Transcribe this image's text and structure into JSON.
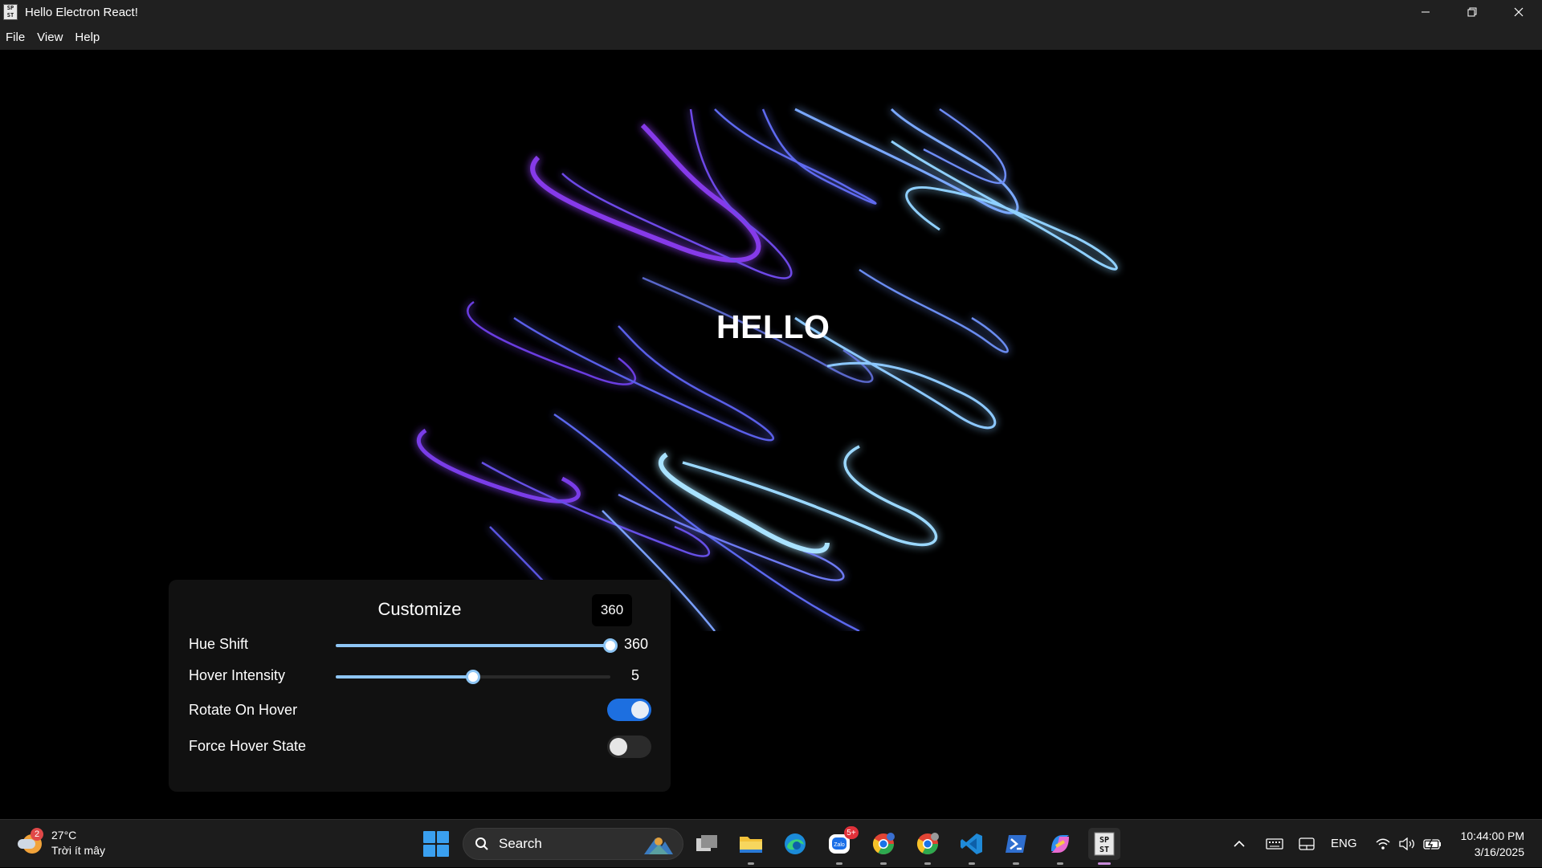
{
  "window": {
    "title": "Hello Electron React!",
    "icon_text_top": "SP",
    "icon_text_bottom": "ST",
    "minimize_icon": "minimize-icon",
    "maximize_icon": "restore-icon",
    "close_icon": "close-icon"
  },
  "menu": {
    "items": [
      {
        "label": "File"
      },
      {
        "label": "View"
      },
      {
        "label": "Help"
      }
    ]
  },
  "main": {
    "heading": "HELLO",
    "artwork": "wavy-purple-blue-lines"
  },
  "customize": {
    "title": "Customize",
    "tooltip": "360",
    "hue_shift": {
      "label": "Hue Shift",
      "value": 360,
      "value_text": "360",
      "max": 360
    },
    "hover_intensity": {
      "label": "Hover Intensity",
      "value": 5,
      "value_text": "5",
      "max": 10
    },
    "rotate_on_hover": {
      "label": "Rotate On Hover",
      "on": true
    },
    "force_hover_state": {
      "label": "Force Hover State",
      "on": false
    },
    "colors": {
      "accent": "#8ec6f5",
      "toggle_on": "#1d6fe0"
    }
  },
  "taskbar": {
    "weather": {
      "temperature": "27°C",
      "description": "Trời ít mây",
      "badge": "2"
    },
    "search": {
      "placeholder": "Search"
    },
    "apps": [
      {
        "name": "task-view-icon"
      },
      {
        "name": "file-explorer-icon"
      },
      {
        "name": "edge-icon"
      },
      {
        "name": "zalo-icon",
        "badge": "5+"
      },
      {
        "name": "chrome-icon"
      },
      {
        "name": "chrome-icon"
      },
      {
        "name": "vscode-icon"
      },
      {
        "name": "powershell-icon"
      },
      {
        "name": "copilot-icon"
      },
      {
        "name": "electron-app-icon"
      }
    ],
    "language": "ENG",
    "time": "10:44:00 PM",
    "date": "3/16/2025"
  }
}
